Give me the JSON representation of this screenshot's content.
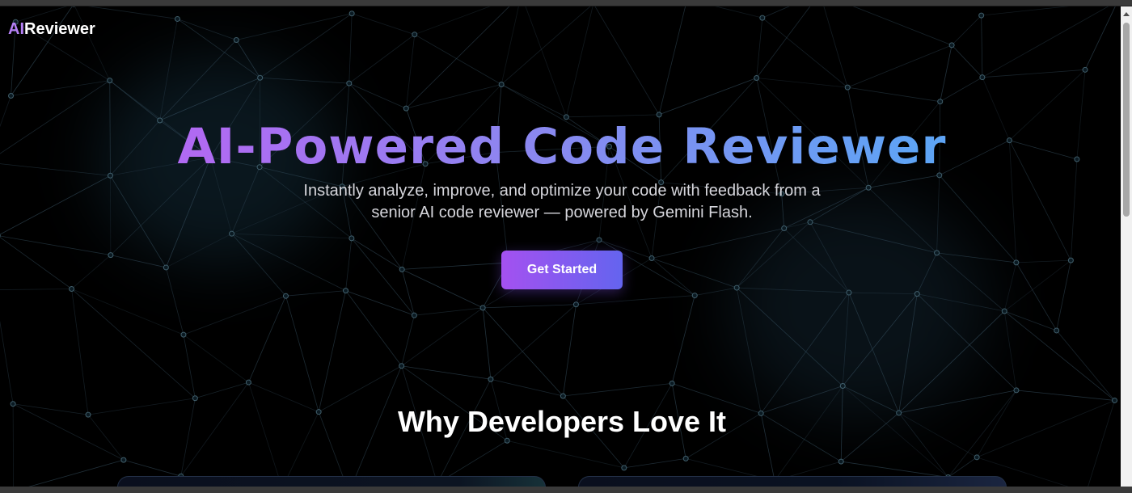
{
  "header": {
    "logo_prefix": "AI",
    "logo_suffix": "Reviewer"
  },
  "hero": {
    "title": "AI-Powered Code Reviewer",
    "subtitle_line1": "Instantly analyze, improve, and optimize your code with feedback from a",
    "subtitle_line2": "senior AI code reviewer — powered by Gemini Flash.",
    "cta_label": "Get Started"
  },
  "features": {
    "title": "Why Developers Love It"
  },
  "colors": {
    "background": "#000000",
    "accent_purple": "#a451f0",
    "accent_blue": "#5ea4f5",
    "network_lines": "#3a5566"
  }
}
